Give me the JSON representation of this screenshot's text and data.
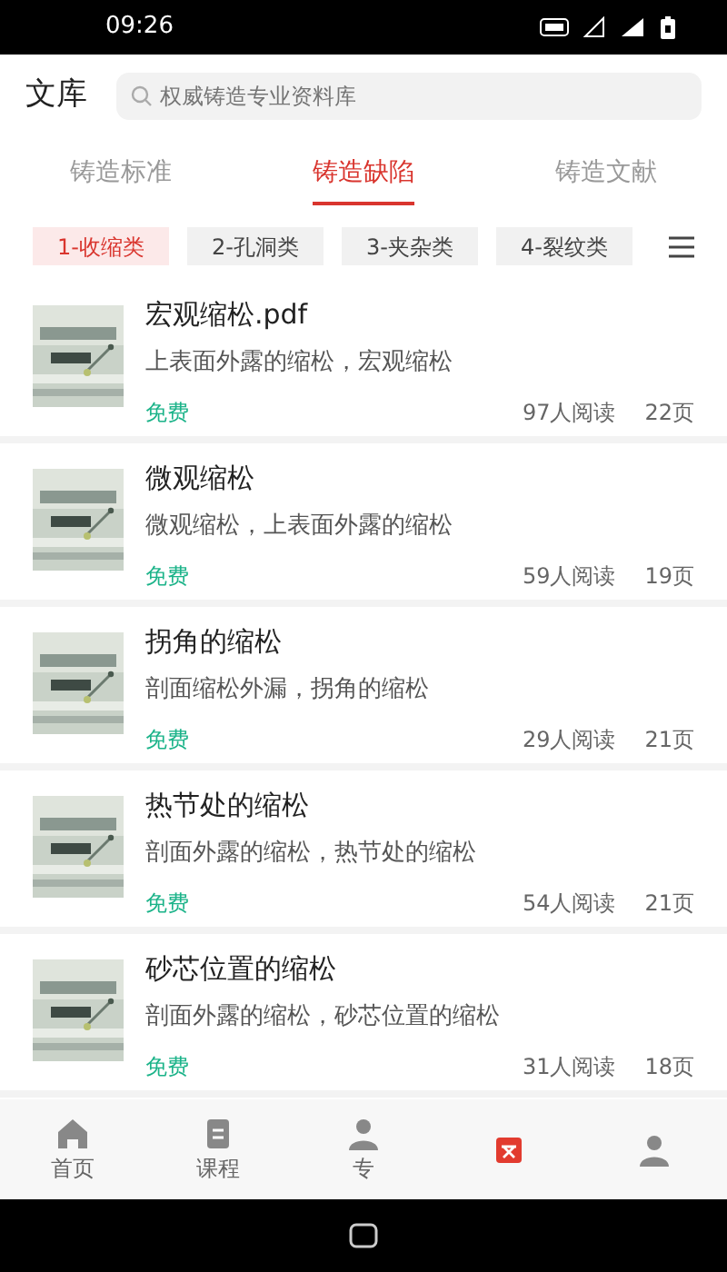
{
  "status_bar": {
    "time": "09:26"
  },
  "header": {
    "title": "文库",
    "search": {
      "placeholder": "权威铸造专业资料库"
    }
  },
  "tabs": [
    {
      "label": "铸造标准",
      "selected": false
    },
    {
      "label": "铸造缺陷",
      "selected": true
    },
    {
      "label": "铸造文献",
      "selected": false
    }
  ],
  "categories": [
    {
      "label": "1-收缩类",
      "selected": true
    },
    {
      "label": "2-孔洞类",
      "selected": false
    },
    {
      "label": "3-夹杂类",
      "selected": false
    },
    {
      "label": "4-裂纹类",
      "selected": false
    }
  ],
  "documents": [
    {
      "title": "宏观缩松.pdf",
      "summary": "上表面外露的缩松，宏观缩松",
      "price": "免费",
      "readers": "97人阅读",
      "pages": "22页"
    },
    {
      "title": "微观缩松",
      "summary": "微观缩松，上表面外露的缩松",
      "price": "免费",
      "readers": "59人阅读",
      "pages": "19页"
    },
    {
      "title": "拐角的缩松",
      "summary": "剖面缩松外漏，拐角的缩松",
      "price": "免费",
      "readers": "29人阅读",
      "pages": "21页"
    },
    {
      "title": "热节处的缩松",
      "summary": "剖面外露的缩松，热节处的缩松",
      "price": "免费",
      "readers": "54人阅读",
      "pages": "21页"
    },
    {
      "title": "砂芯位置的缩松",
      "summary": "剖面外露的缩松，砂芯位置的缩松",
      "price": "免费",
      "readers": "31人阅读",
      "pages": "18页"
    }
  ],
  "bottom_nav": [
    {
      "kind": "home",
      "label": "首页",
      "selected": false
    },
    {
      "kind": "course",
      "label": "课程",
      "selected": false
    },
    {
      "kind": "person",
      "label": "专",
      "selected": false
    },
    {
      "kind": "library",
      "selected": true
    },
    {
      "kind": "person"
    }
  ]
}
